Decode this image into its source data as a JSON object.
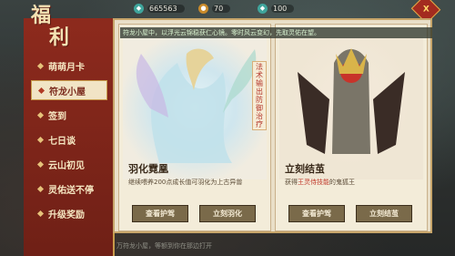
{
  "resources": {
    "jade": "665563",
    "gold": "70",
    "tickets": "100"
  },
  "close_label": "X",
  "title": {
    "line1": "福",
    "line2": "利"
  },
  "menu": [
    "萌萌月卡",
    "符龙小屋",
    "签到",
    "七日谈",
    "云山初见",
    "灵佑送不停",
    "升级奖励"
  ],
  "notice": "符龙小屋中，以浮光云锦稳获仁心镜。零时风云变幻，先取灵佑在望。",
  "cards": [
    {
      "vertical": "法术输出防御治疗",
      "name": "羽化霓凰",
      "desc": "继续喂养200点成长值可羽化为上古异兽",
      "btn1": "查看护驾",
      "btn2": "立刻羽化"
    },
    {
      "name": "立刻结茧",
      "desc_pre": "获得",
      "desc_hl": "王灵侍技能",
      "desc_post": "的鬼狐王",
      "btn1": "查看护驾",
      "btn2": "立刻结茧"
    }
  ],
  "footer": "万符龙小屋，等额到你在那边打开"
}
